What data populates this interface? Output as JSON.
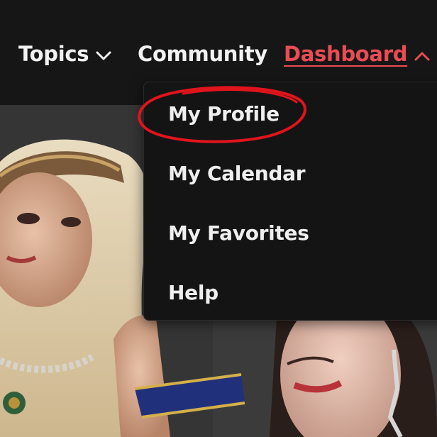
{
  "nav": {
    "topics_label": "Topics",
    "community_label": "Community",
    "dashboard_label": "Dashboard",
    "dashboard_active_color": "#ea4c55",
    "topics_icon": "chevron-down-icon",
    "dashboard_icon": "chevron-up-icon"
  },
  "dropdown": {
    "items": [
      {
        "label": "My Profile",
        "highlighted": true
      },
      {
        "label": "My Calendar"
      },
      {
        "label": "My Favorites"
      },
      {
        "label": "Help"
      }
    ]
  },
  "annotation": {
    "type": "red-ellipse-circle",
    "color": "#e0141c",
    "target": "My Profile"
  },
  "hero": {
    "description_icon": "photo-of-dancers-image"
  }
}
